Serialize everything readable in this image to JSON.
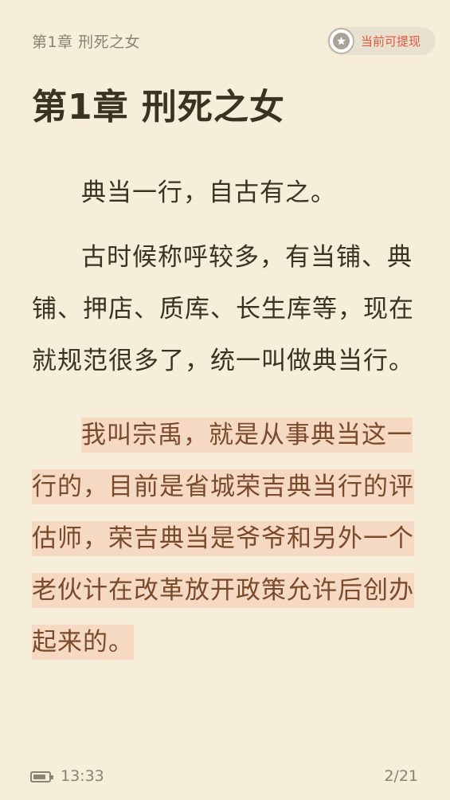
{
  "header": {
    "running_title": "第1章  刑死之女",
    "withdraw_label": "当前可提现",
    "withdraw_icon": "star-coin-icon"
  },
  "chapter": {
    "title": "第1章  刑死之女",
    "paragraphs": [
      "典当一行，自古有之。",
      "古时候称呼较多，有当铺、典铺、押店、质库、长生库等，现在就规范很多了，统一叫做典当行。"
    ],
    "highlighted_paragraph": "我叫宗禹，就是从事典当这一行的，目前是省城荣吉典当行的评估师，荣吉典当是爷爷和另外一个老伙计在改革放开政策允许后创办起来的。"
  },
  "footer": {
    "time": "13:33",
    "page": "2/21",
    "battery_level": 0.85
  },
  "colors": {
    "background": "#f6eed9",
    "text": "#3b3322",
    "highlight_bg": "#f6d9c2",
    "accent": "#e2563f"
  }
}
